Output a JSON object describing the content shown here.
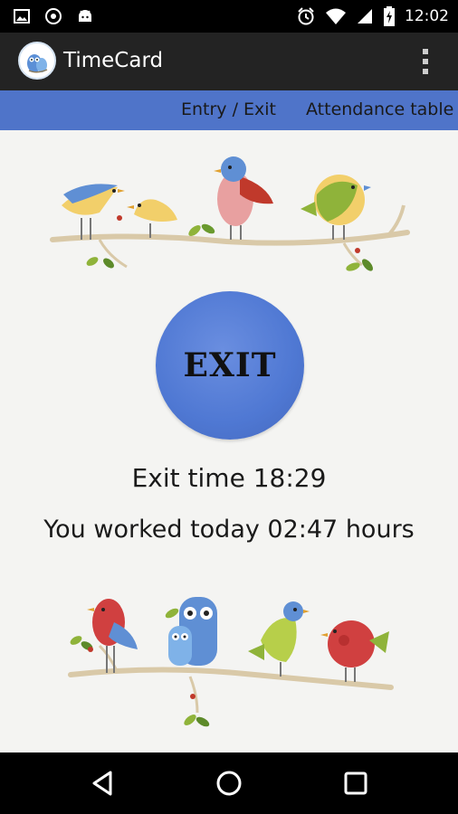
{
  "status_bar": {
    "time": "12:02",
    "icons": [
      "gallery-icon",
      "sync-icon",
      "android-icon",
      "alarm-icon",
      "wifi-icon",
      "signal-icon",
      "battery-charging-icon"
    ]
  },
  "action_bar": {
    "title": "TimeCard",
    "logo_icon": "owl-icon",
    "menu_icon": "overflow-menu-icon"
  },
  "tabs": [
    {
      "label": "Entry / Exit",
      "selected": true
    },
    {
      "label": "Attendance table",
      "selected": false
    }
  ],
  "exit_button": {
    "label": "EXIT",
    "color": "#4f78d3"
  },
  "exit_time": "Exit time 18:29",
  "worked_today": "You worked today 02:47 hours",
  "nav_bar": {
    "icons": [
      "back-icon",
      "home-icon",
      "recents-icon"
    ]
  },
  "colors": {
    "tab_bar": "#4f74c9",
    "action_bar": "#232323",
    "background": "#f4f4f2"
  }
}
